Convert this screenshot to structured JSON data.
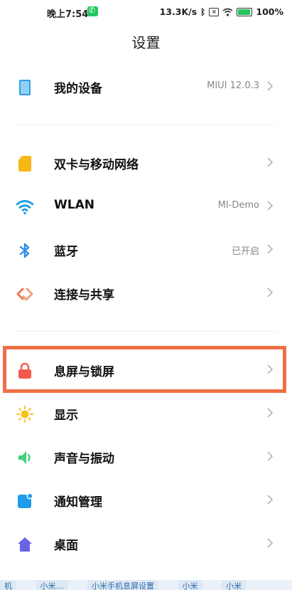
{
  "status_bar": {
    "time": "晚上7:54",
    "speed": "13.3K/s",
    "battery": "100%",
    "battery_level": 1.0,
    "icons": [
      "phone-icon",
      "bluetooth-icon",
      "sim-icon",
      "wifi-icon",
      "battery-icon"
    ]
  },
  "header": {
    "title": "设置"
  },
  "items": [
    {
      "label": "我的设备",
      "value": "MIUI 12.0.3",
      "icon": "tablet-icon",
      "color": "#3b9de6"
    },
    {
      "label": "双卡与移动网络",
      "value": "",
      "icon": "sim-card-icon",
      "color": "#f6b816"
    },
    {
      "label": "WLAN",
      "value": "MI-Demo",
      "icon": "wifi-icon",
      "color": "#1a9fe8"
    },
    {
      "label": "蓝牙",
      "value": "已开启",
      "icon": "bluetooth-icon",
      "color": "#2b8ce6"
    },
    {
      "label": "连接与共享",
      "value": "",
      "icon": "share-icon",
      "color": "#ef7a55"
    },
    {
      "label": "息屏与锁屏",
      "value": "",
      "icon": "lock-icon",
      "color": "#f25b4c"
    },
    {
      "label": "显示",
      "value": "",
      "icon": "sun-icon",
      "color": "#f8c21a"
    },
    {
      "label": "声音与振动",
      "value": "",
      "icon": "speaker-icon",
      "color": "#3ed37a"
    },
    {
      "label": "通知管理",
      "value": "",
      "icon": "notification-icon",
      "color": "#1e9be9"
    },
    {
      "label": "桌面",
      "value": "",
      "icon": "home-icon",
      "color": "#6b63e6"
    }
  ],
  "highlight_color": "#f07046",
  "footer_links": [
    "机",
    "小米…",
    "小米手机息屏设置",
    "小米",
    "小米"
  ]
}
